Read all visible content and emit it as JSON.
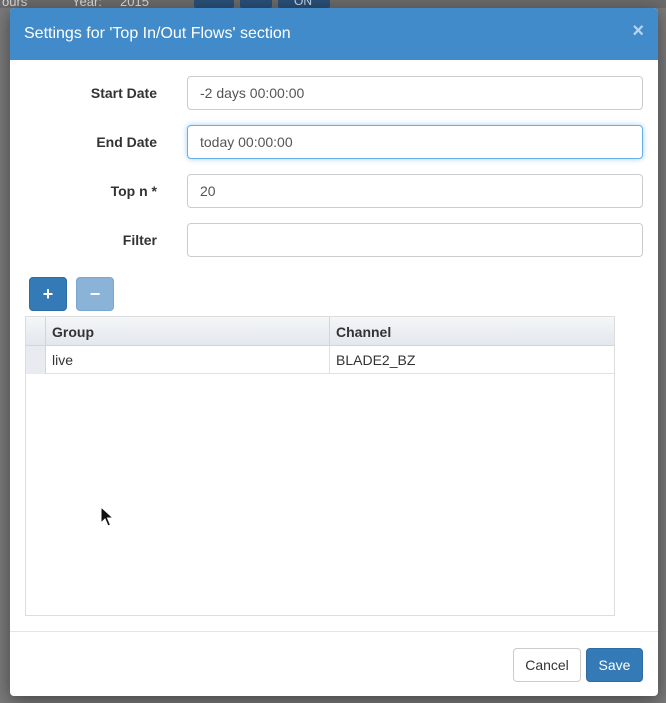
{
  "background": {
    "items": [
      "ours",
      "Year:",
      "2015",
      "ON"
    ]
  },
  "dialog": {
    "title": "Settings for 'Top In/Out Flows' section",
    "close_symbol": "×",
    "fields": [
      {
        "label": "Start Date",
        "value": "-2 days 00:00:00"
      },
      {
        "label": "End Date",
        "value": "today 00:00:00"
      },
      {
        "label": "Top n *",
        "value": "20"
      },
      {
        "label": "Filter",
        "value": ""
      }
    ],
    "add_symbol": "+",
    "remove_symbol": "−",
    "grid": {
      "columns": [
        "Group",
        "Channel"
      ],
      "rows": [
        {
          "group": "live",
          "channel": "BLADE2_BZ"
        }
      ]
    },
    "buttons": {
      "cancel": "Cancel",
      "save": "Save"
    }
  },
  "colors": {
    "header": "#428bca",
    "primary": "#337ab7"
  }
}
